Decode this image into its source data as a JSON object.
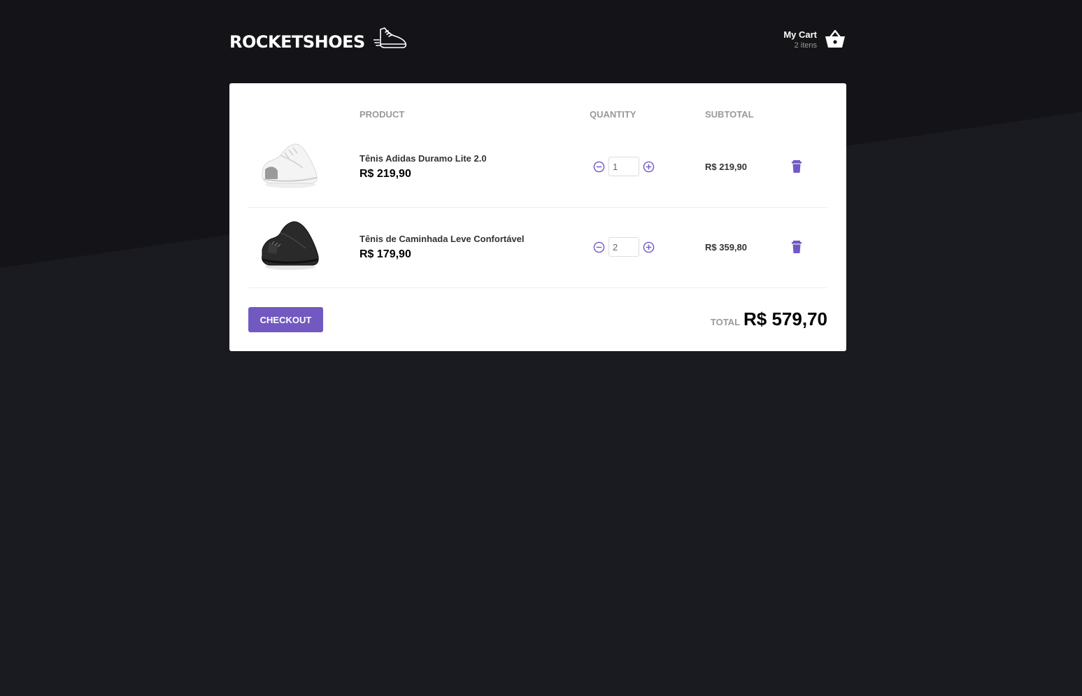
{
  "colors": {
    "background": "#1a1b20",
    "background_upper": "#141418",
    "accent": "#7159c1",
    "panel": "#ffffff"
  },
  "header": {
    "logo_text": "ROCKETSHOES",
    "logo_icon": "sneaker-icon",
    "cart": {
      "title": "My Cart",
      "count_text": "2 itens",
      "icon": "basket-icon"
    }
  },
  "cart_table": {
    "columns": [
      "PRODUCT",
      "QUANTITY",
      "SUBTOTAL"
    ],
    "items": [
      {
        "name": "Tênis Adidas Duramo Lite 2.0",
        "price": "R$ 219,90",
        "quantity": "1",
        "subtotal": "R$ 219,90",
        "image_color": "white"
      },
      {
        "name": "Tênis de Caminhada Leve Confortável",
        "price": "R$ 179,90",
        "quantity": "2",
        "subtotal": "R$ 359,80",
        "image_color": "black"
      }
    ]
  },
  "footer": {
    "checkout_label": "CHECKOUT",
    "total_label": "TOTAL",
    "total_value": "R$ 579,70"
  }
}
